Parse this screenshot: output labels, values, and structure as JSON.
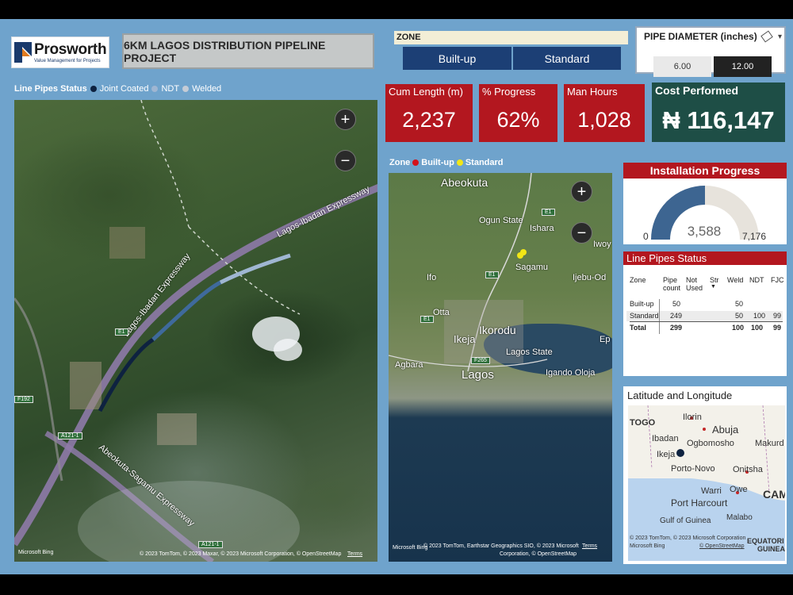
{
  "header": {
    "logo_name": "Prosworth",
    "logo_tagline": "Value Management for Projects",
    "title": "6KM LAGOS DISTRIBUTION PIPELINE PROJECT"
  },
  "zone_filter": {
    "label": "ZONE",
    "options": [
      "Built-up",
      "Standard"
    ]
  },
  "pipe_diameter": {
    "label": "PIPE DIAMETER (inches)",
    "options": [
      "6.00",
      "12.00"
    ],
    "selected": "12.00"
  },
  "line_pipes_legend": {
    "title": "Line Pipes Status",
    "items": [
      {
        "label": "Joint Coated",
        "color": "#0e2240"
      },
      {
        "label": "NDT",
        "color": "#9fb6d2"
      },
      {
        "label": "Welded",
        "color": "#c5ccd6"
      }
    ]
  },
  "kpis": {
    "cum_length": {
      "label": "Cum Length (m)",
      "value": "2,237"
    },
    "progress": {
      "label": "% Progress",
      "value": "62%"
    },
    "man_hours": {
      "label": "Man Hours",
      "value": "1,028"
    },
    "cost": {
      "label": "Cost Performed",
      "value": "₦ 116,147"
    }
  },
  "zone_legend": {
    "title": "Zone",
    "items": [
      {
        "label": "Built-up",
        "color": "#d4121a"
      },
      {
        "label": "Standard",
        "color": "#f2e616"
      }
    ]
  },
  "left_map": {
    "labels": [
      "Lagos-Ibadan Expressway",
      "Lagos-Ibadan Expressway",
      "Abeokuta-Sagamu Expressway"
    ],
    "shields": [
      "E1",
      "F192",
      "A121-1",
      "A121-1"
    ],
    "credit": "© 2023 TomTom, © 2023 Maxar, © 2023 Microsoft Corporation, © OpenStreetMap",
    "terms": "Terms",
    "bing": "Microsoft Bing"
  },
  "mid_map": {
    "labels": [
      "Abeokuta",
      "Ogun State",
      "Ishara",
      "Sagamu",
      "Ifo",
      "Ijebu-Od",
      "Iwoy",
      "Otta",
      "Ikorodu",
      "Ikeja",
      "Lagos State",
      "Agbara",
      "Lagos",
      "Igando Oloja",
      "Ep"
    ],
    "shields": [
      "E1",
      "E1",
      "E1",
      "F265"
    ],
    "credit_line1": "© 2023 TomTom, Earthstar Geographics SIO, © 2023 Microsoft",
    "credit_line2": "Corporation, © OpenStreetMap",
    "terms": "Terms",
    "bing": "Microsoft Bing"
  },
  "installation_progress": {
    "title": "Installation Progress",
    "value": "3,588",
    "min": "0",
    "max": "7,176",
    "fraction": 0.5,
    "fill_color": "#3d6591",
    "track_color": "#e7e3dc"
  },
  "line_pipes_table": {
    "title": "Line Pipes Status",
    "headers": [
      "Zone",
      "Pipe count",
      "Not Used",
      "Str",
      "Weld",
      "NDT",
      "FJC"
    ],
    "rows": [
      [
        "Built-up",
        "50",
        "",
        "",
        "50",
        "",
        ""
      ],
      [
        "Standard",
        "249",
        "",
        "",
        "50",
        "100",
        "99"
      ]
    ],
    "total": [
      "Total",
      "299",
      "",
      "",
      "100",
      "100",
      "99"
    ]
  },
  "latlong": {
    "title": "Latitude and Longitude",
    "labels": [
      "TOGO",
      "Ilorin",
      "Abuja",
      "Ibadan",
      "Ogbomosho",
      "Makurd",
      "Ikeja",
      "Porto-Novo",
      "Onitsha",
      "Warri",
      "Owe",
      "Port Harcourt",
      "Gulf of Guinea",
      "Malabo",
      "CAM",
      "EQUATORI",
      "GUINEA"
    ],
    "credit_line1": "© 2023 TomTom, © 2023 Microsoft Corporation",
    "credit_line2": "© OpenStreetMap",
    "bing": "Microsoft Bing"
  }
}
